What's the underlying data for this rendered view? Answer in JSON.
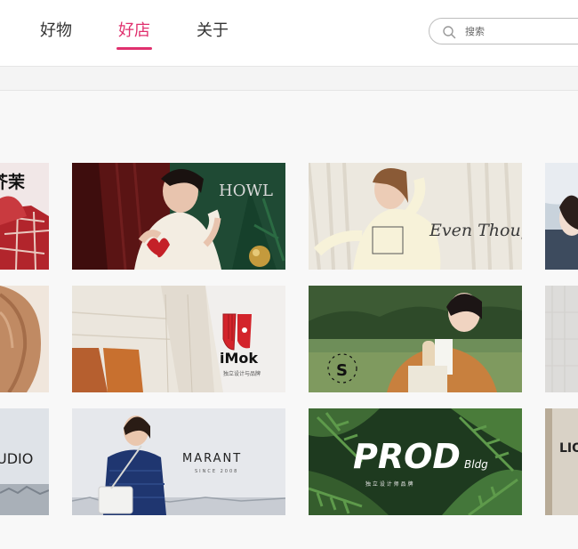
{
  "nav": {
    "tabs": [
      {
        "label": "好物",
        "active": false
      },
      {
        "label": "好店",
        "active": true
      },
      {
        "label": "关于",
        "active": false
      }
    ],
    "accent_color": "#e0306e"
  },
  "search": {
    "placeholder": "搜索",
    "value": "",
    "icon": "search-icon"
  },
  "shops": [
    {
      "name": "芥茉",
      "brand_text": "芥茉",
      "position": "row1-left-partial"
    },
    {
      "name": "HOWL",
      "brand_text": "HOWL",
      "position": "row1-col1"
    },
    {
      "name": "Even Though",
      "brand_text": "Even Though",
      "position": "row1-col2"
    },
    {
      "name": "",
      "brand_text": "",
      "position": "row1-right-partial"
    },
    {
      "name": "",
      "brand_text": "",
      "position": "row2-left-partial"
    },
    {
      "name": "iMok",
      "brand_text": "iMok",
      "sub_text": "独立设计与品牌",
      "position": "row2-col1"
    },
    {
      "name": "S",
      "brand_text": "S",
      "position": "row2-col2"
    },
    {
      "name": "",
      "brand_text": "",
      "position": "row2-right-partial"
    },
    {
      "name": "STUDIO",
      "brand_text": "UDIO",
      "position": "row3-left-partial"
    },
    {
      "name": "MARANT",
      "brand_text": "MARANT",
      "sub_text": "SINCE 2008",
      "position": "row3-col1"
    },
    {
      "name": "PROD Bldg",
      "brand_text": "PROD",
      "sub_text": "Bldg",
      "tagline": "独 立 设 计 师 品 牌",
      "position": "row3-col2"
    },
    {
      "name": "LIO",
      "brand_text": "LIO",
      "position": "row3-right-partial"
    }
  ]
}
